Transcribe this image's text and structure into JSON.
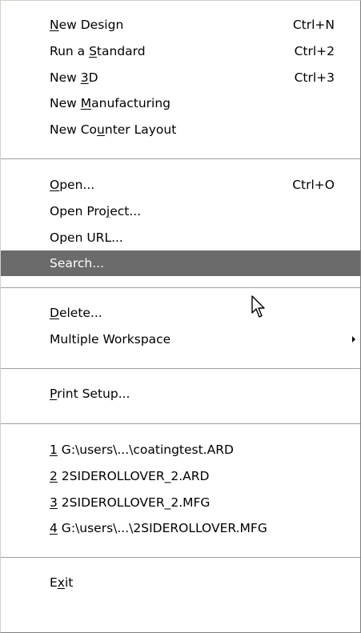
{
  "menu": {
    "items": [
      {
        "pre": "",
        "key": "N",
        "post": "ew Design",
        "shortcut": "Ctrl+N"
      },
      {
        "pre": "Run a ",
        "key": "S",
        "post": "tandard",
        "shortcut": "Ctrl+2"
      },
      {
        "pre": "New ",
        "key": "3",
        "post": "D",
        "shortcut": "Ctrl+3"
      },
      {
        "pre": "New ",
        "key": "M",
        "post": "anufacturing",
        "shortcut": ""
      },
      {
        "pre": "New Co",
        "key": "u",
        "post": "nter Layout",
        "shortcut": ""
      },
      {
        "pre": "",
        "key": "O",
        "post": "pen...",
        "shortcut": "Ctrl+O"
      },
      {
        "pre": "Open Pro",
        "key": "j",
        "post": "ect...",
        "shortcut": ""
      },
      {
        "pre": "Open URL...",
        "key": "",
        "post": "",
        "shortcut": ""
      },
      {
        "pre": "Search...",
        "key": "",
        "post": "",
        "shortcut": ""
      },
      {
        "pre": "",
        "key": "D",
        "post": "elete...",
        "shortcut": ""
      },
      {
        "pre": "Multiple Workspace",
        "key": "",
        "post": "",
        "shortcut": ""
      },
      {
        "pre": "",
        "key": "P",
        "post": "rint Setup...",
        "shortcut": ""
      },
      {
        "pre": "",
        "key": "1",
        "post": " G:\\users\\...\\coatingtest.ARD",
        "shortcut": ""
      },
      {
        "pre": "",
        "key": "2",
        "post": " 2SIDEROLLOVER_2.ARD",
        "shortcut": ""
      },
      {
        "pre": "",
        "key": "3",
        "post": " 2SIDEROLLOVER_2.MFG",
        "shortcut": ""
      },
      {
        "pre": "",
        "key": "4",
        "post": " G:\\users\\...\\2SIDEROLLOVER.MFG",
        "shortcut": ""
      },
      {
        "pre": "E",
        "key": "x",
        "post": "it",
        "shortcut": ""
      }
    ],
    "highlighted_item": "Search...",
    "highlight_color": "#6b6b6b",
    "submenu_arrow_icon": "triangle-right-icon",
    "cursor_icon": "arrow-cursor-icon"
  }
}
